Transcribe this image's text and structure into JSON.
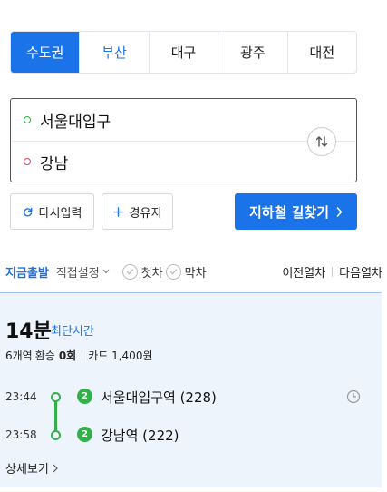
{
  "regions": [
    {
      "label": "수도권",
      "state": "active"
    },
    {
      "label": "부산",
      "state": "highlight"
    },
    {
      "label": "대구",
      "state": "normal"
    },
    {
      "label": "광주",
      "state": "normal"
    },
    {
      "label": "대전",
      "state": "normal"
    }
  ],
  "route": {
    "start": "서울대입구",
    "end": "강남"
  },
  "actions": {
    "reset_label": "다시입력",
    "via_label": "경유지",
    "search_label": "지하철 길찾기"
  },
  "options": {
    "now": "지금출발",
    "direct": "직접설정",
    "first_train": "첫차",
    "last_train": "막차",
    "prev_train": "이전열차",
    "next_train": "다음열차"
  },
  "result": {
    "duration": "14분",
    "duration_label": "최단시간",
    "stations_text": "6개역",
    "transfer_label": "환승",
    "transfer_count": "0회",
    "fare": "카드 1,400원",
    "detail_label": "상세보기",
    "stops": [
      {
        "time": "23:44",
        "line": "2",
        "name": "서울대입구역 (228)"
      },
      {
        "time": "23:58",
        "line": "2",
        "name": "강남역 (222)"
      }
    ]
  },
  "colors": {
    "accent": "#1a73e8",
    "line2": "#33b04a",
    "start_dot": "#2db84c",
    "end_dot": "#e0465d"
  },
  "icons": {
    "swap": "swap-vertical-icon",
    "reset": "refresh-icon",
    "via": "plus-icon",
    "clock": "clock-icon"
  }
}
